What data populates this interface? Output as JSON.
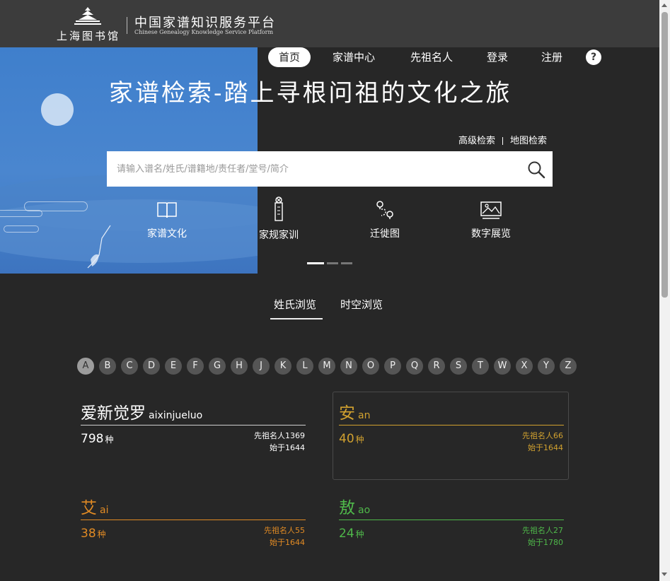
{
  "header": {
    "logo_text": "上海图书馆",
    "platform_title": "中国家谱知识服务平台",
    "platform_subtitle": "Chinese Genealogy Knowledge Service Platform"
  },
  "nav": {
    "items": [
      "首页",
      "家谱中心",
      "先祖名人",
      "登录",
      "注册"
    ],
    "active": "首页",
    "help_label": "?"
  },
  "banner": {
    "headline": "家谱检索-踏上寻根问祖的文化之旅",
    "advanced_search": "高级检索",
    "map_search": "地图检索",
    "search_placeholder": "请输入谱名/姓氏/谱籍地/责任者/堂号/简介",
    "search_value": "",
    "features": [
      {
        "label": "家谱文化",
        "icon": "book-icon"
      },
      {
        "label": "家规家训",
        "icon": "scroll-icon"
      },
      {
        "label": "迁徙图",
        "icon": "route-icon"
      },
      {
        "label": "数字展览",
        "icon": "exhibition-icon"
      }
    ],
    "carousel_slides": 3,
    "carousel_active": 1
  },
  "tabs": {
    "items": [
      "姓氏浏览",
      "时空浏览"
    ],
    "active": "姓氏浏览"
  },
  "letters": {
    "items": [
      "A",
      "B",
      "C",
      "D",
      "E",
      "F",
      "G",
      "H",
      "J",
      "K",
      "L",
      "M",
      "N",
      "O",
      "P",
      "Q",
      "R",
      "S",
      "T",
      "W",
      "X",
      "Y",
      "Z"
    ],
    "active": "A"
  },
  "surnames": [
    {
      "name": "爱新觉罗",
      "pinyin": "aixinjueluo",
      "count": "798",
      "unit": "种",
      "ancestors": "先祖名人1369",
      "since": "始于1644",
      "color": "#ffffff",
      "line_color": "#cfcfcf"
    },
    {
      "name": "安",
      "pinyin": "an",
      "count": "40",
      "unit": "种",
      "ancestors": "先祖名人66",
      "since": "始于1644",
      "color": "#d1a12f",
      "line_color": "#d1a12f"
    },
    {
      "name": "艾",
      "pinyin": "ai",
      "count": "38",
      "unit": "种",
      "ancestors": "先祖名人55",
      "since": "始于1644",
      "color": "#e08a24",
      "line_color": "#e08a24"
    },
    {
      "name": "敖",
      "pinyin": "ao",
      "count": "24",
      "unit": "种",
      "ancestors": "先祖名人27",
      "since": "始于1780",
      "color": "#4fb84a",
      "line_color": "#4fb84a"
    }
  ]
}
